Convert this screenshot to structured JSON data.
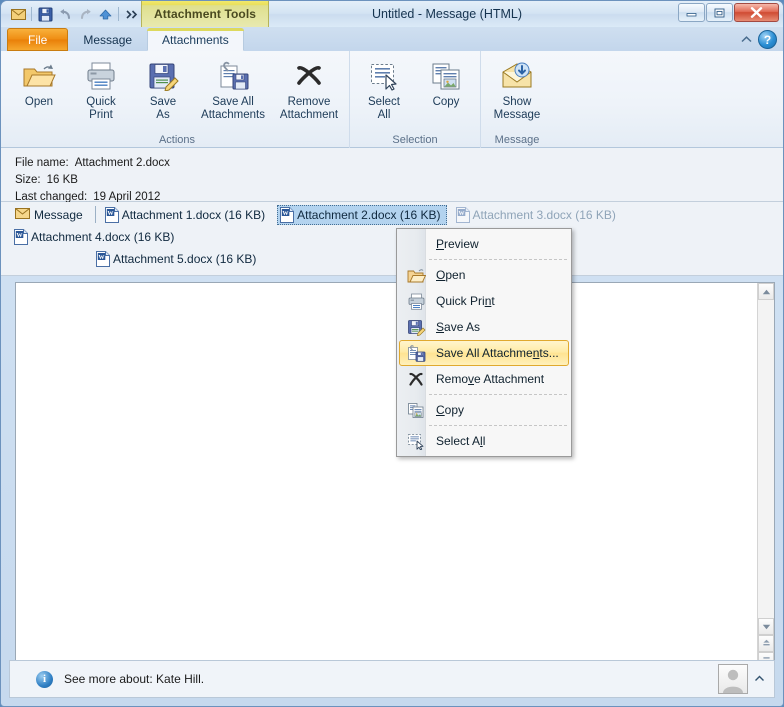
{
  "window": {
    "title": "Untitled  -  Message (HTML)",
    "contextual_tools_label": "Attachment Tools",
    "app_icon": "envelope-icon",
    "controls": {
      "minimize": "–",
      "maximize": "❐",
      "close": "✕"
    }
  },
  "quick_access_toolbar": {
    "items": [
      {
        "name": "save-icon",
        "tooltip": "Save"
      },
      {
        "name": "undo-icon",
        "tooltip": "Undo"
      },
      {
        "name": "redo-icon",
        "tooltip": "Redo"
      },
      {
        "name": "previous-item-icon",
        "tooltip": "Previous Item"
      },
      {
        "name": "customize-qat-icon",
        "tooltip": "Customize Quick Access Toolbar"
      }
    ]
  },
  "tabs": {
    "file": "File",
    "items": [
      {
        "label": "Message",
        "active": false
      },
      {
        "label": "Attachments",
        "active": true
      }
    ],
    "minimize_ribbon_icon": "chevron-up-icon",
    "help_label": "?"
  },
  "ribbon": {
    "groups": [
      {
        "title": "Actions",
        "buttons": [
          {
            "label": "Open",
            "icon": "open-folder-icon"
          },
          {
            "label": "Quick\nPrint",
            "line1": "Quick",
            "line2": "Print",
            "icon": "printer-icon"
          },
          {
            "label": "Save\nAs",
            "line1": "Save",
            "line2": "As",
            "icon": "save-as-icon"
          },
          {
            "label": "Save All\nAttachments",
            "line1": "Save All",
            "line2": "Attachments",
            "icon": "save-all-attachments-icon"
          },
          {
            "label": "Remove\nAttachment",
            "line1": "Remove",
            "line2": "Attachment",
            "icon": "remove-attachment-icon"
          }
        ]
      },
      {
        "title": "Selection",
        "buttons": [
          {
            "label": "Select\nAll",
            "line1": "Select",
            "line2": "All",
            "icon": "select-all-icon"
          },
          {
            "label": "Copy",
            "line1": "Copy",
            "line2": "",
            "icon": "copy-icon"
          }
        ]
      },
      {
        "title": "Message",
        "buttons": [
          {
            "label": "Show\nMessage",
            "line1": "Show",
            "line2": "Message",
            "icon": "show-message-icon"
          }
        ]
      }
    ]
  },
  "info_panel": {
    "file_name_label": "File name:",
    "file_name_value": "Attachment 2.docx",
    "size_label": "Size:",
    "size_value": "16 KB",
    "last_changed_label": "Last changed:",
    "last_changed_value": "19 April 2012"
  },
  "attachment_bar": {
    "message_tab": "Message",
    "attachments": [
      {
        "label": "Attachment 1.docx (16 KB)",
        "selected": false
      },
      {
        "label": "Attachment 2.docx (16 KB)",
        "selected": true
      },
      {
        "label": "Attachment 3.docx (16 KB)",
        "selected": false
      },
      {
        "label": "Attachment 4.docx (16 KB)",
        "selected": false
      },
      {
        "label": "Attachment 5.docx (16 KB)",
        "selected": false
      }
    ]
  },
  "context_menu": {
    "items": [
      {
        "label": "Preview",
        "accel": "P",
        "icon": null,
        "highlighted": false,
        "separator_after": true
      },
      {
        "label": "Open",
        "accel": "O",
        "icon": "open-folder-icon",
        "highlighted": false,
        "separator_after": false
      },
      {
        "label": "Quick Print",
        "accel": "n",
        "icon": "printer-icon",
        "highlighted": false,
        "separator_after": false
      },
      {
        "label": "Save As",
        "accel": "S",
        "icon": "save-as-icon",
        "highlighted": false,
        "separator_after": false
      },
      {
        "label": "Save All Attachments...",
        "accel": "n",
        "icon": "save-all-attachments-icon",
        "highlighted": true,
        "separator_after": false
      },
      {
        "label": "Remove Attachment",
        "accel": "v",
        "icon": "remove-attachment-icon",
        "highlighted": false,
        "separator_after": true
      },
      {
        "label": "Copy",
        "accel": "C",
        "icon": "copy-icon",
        "highlighted": false,
        "separator_after": true
      },
      {
        "label": "Select All",
        "accel": "l",
        "icon": "select-all-icon",
        "highlighted": false,
        "separator_after": false
      }
    ]
  },
  "status_bar": {
    "info_icon": "info-icon",
    "text": "See more about: Kate Hill.",
    "avatar": "person-avatar",
    "expand_icon": "chevron-up-icon"
  },
  "colors": {
    "contextual_tab": "#e9df5c",
    "file_tab": "#ef8c12",
    "selection_blue": "#b3d3ef",
    "menu_highlight": "#ffe492",
    "menu_highlight_border": "#e0a92e",
    "close_button": "#cf4a32"
  }
}
